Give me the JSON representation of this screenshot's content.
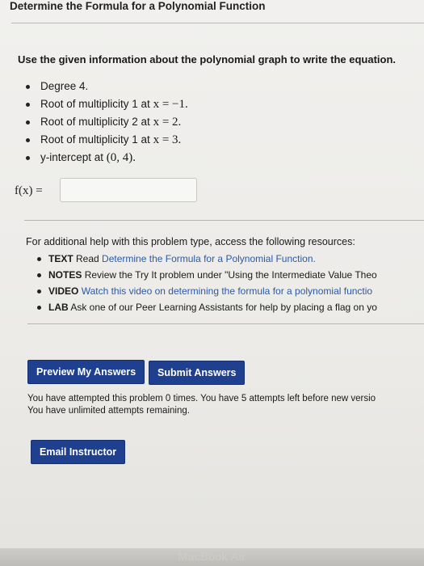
{
  "header": {
    "title": "Determine the Formula for a Polynomial Function"
  },
  "problem": {
    "prompt": "Use the given information about the polynomial graph to write the equation.",
    "facts": [
      {
        "text": "Degree 4.",
        "math": ""
      },
      {
        "text": "Root of multiplicity 1 at ",
        "math": "x = −1."
      },
      {
        "text": "Root of multiplicity 2 at ",
        "math": "x = 2."
      },
      {
        "text": "Root of multiplicity 1 at ",
        "math": "x = 3."
      },
      {
        "text": "y-intercept at ",
        "math": "(0, 4)."
      }
    ],
    "answer_label": "f(x) =",
    "answer_value": "",
    "answer_placeholder": ""
  },
  "help": {
    "title": "For additional help with this problem type, access the following resources:",
    "resources": [
      {
        "kind": "TEXT",
        "text": "Read ",
        "link": "Determine the Formula for a Polynomial Function."
      },
      {
        "kind": "NOTES",
        "text": "Review the Try It problem under \"Using the Intermediate Value Theo",
        "link": ""
      },
      {
        "kind": "VIDEO",
        "text": "",
        "link": "Watch this video on determining the formula for a polynomial functio"
      },
      {
        "kind": "LAB",
        "text": "Ask one of our Peer Learning Assistants for help by placing a flag on yo",
        "link": ""
      }
    ]
  },
  "actions": {
    "preview_label": "Preview My Answers",
    "submit_label": "Submit Answers",
    "email_label": "Email Instructor"
  },
  "status": {
    "attempts_line": "You have attempted this problem 0 times. You have 5 attempts left before new versio",
    "unlimited_line": "You have unlimited attempts remaining."
  },
  "device": {
    "brand": "MacBook Air"
  },
  "colors": {
    "button": "#1f3f8f",
    "link": "#2a5aa8"
  }
}
